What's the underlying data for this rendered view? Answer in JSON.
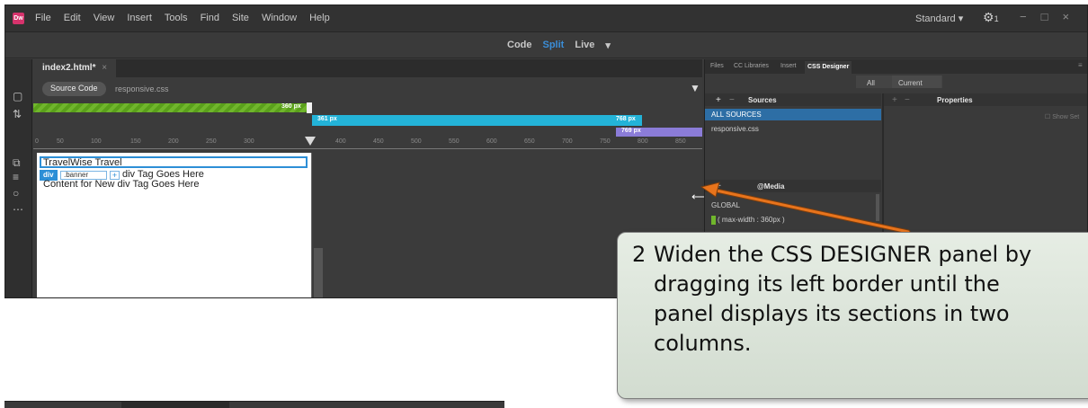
{
  "menubar": {
    "logo": "Dw",
    "items": [
      "File",
      "Edit",
      "View",
      "Insert",
      "Tools",
      "Find",
      "Site",
      "Window",
      "Help"
    ],
    "workspace": "Standard",
    "workspace_caret": "▾",
    "sync_icon": "gear-icon",
    "sync_count": "1",
    "window_buttons": [
      "−",
      "□",
      "×"
    ]
  },
  "viewbar": {
    "code": "Code",
    "split": "Split",
    "live": "Live",
    "live_caret": "▾",
    "active": "Split",
    "active_color": "#3b8ed8"
  },
  "document": {
    "tab": "index2.html*",
    "tab_close": "×",
    "source_code": "Source Code",
    "related_file": "responsive.css",
    "design_text": {
      "banner": "TravelWise Travel",
      "tag_name": "div",
      "tag_class": ".banner",
      "tag_plus": "+",
      "tag_text": "div Tag Goes Here",
      "content": "Content for New div Tag Goes Here"
    }
  },
  "media_queries": {
    "bar1_label": "360 px",
    "bar2_left": "361 px",
    "bar2_right": "768 px",
    "bar3_label": "769 px",
    "colors": {
      "bar1": "#70b62c",
      "bar2": "#23b3d8",
      "bar3": "#8b7cd8"
    }
  },
  "ruler": {
    "ticks": [
      "0",
      "50",
      "100",
      "150",
      "200",
      "250",
      "300",
      "400",
      "450",
      "500",
      "550",
      "600",
      "650",
      "700",
      "750",
      "800",
      "850"
    ]
  },
  "panel": {
    "tabs": [
      "Files",
      "CC Libraries",
      "Insert",
      "CSS Designer"
    ],
    "active_tab": "CSS Designer",
    "toggle_all": "All",
    "toggle_current": "Current",
    "sources_title": "Sources",
    "properties_title": "Properties",
    "show_set": "Show Set",
    "sources": [
      "ALL SOURCES",
      "responsive.css"
    ],
    "media_title": "@Media",
    "media_items": [
      "GLOBAL",
      "( max-width : 360px )"
    ],
    "selected_color": "#2d6ea5"
  },
  "callout": {
    "number": "2",
    "lines": [
      "Widen the CSS DESIGNER panel by",
      "dragging its left border until the",
      "panel displays its sections in two",
      "columns."
    ]
  }
}
